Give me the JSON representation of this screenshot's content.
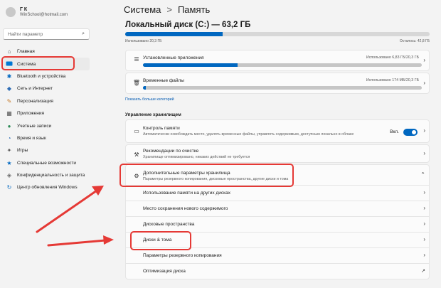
{
  "user": {
    "name": "Г К",
    "email": "WinSchool@hotmail.com"
  },
  "search": {
    "placeholder": "Найти параметр"
  },
  "sidebar": {
    "items": [
      {
        "label": "Главная",
        "icon": "home-icon"
      },
      {
        "label": "Система",
        "icon": "system-icon",
        "active": true
      },
      {
        "label": "Bluetooth и устройства",
        "icon": "bluetooth-icon"
      },
      {
        "label": "Сеть и Интернет",
        "icon": "network-icon"
      },
      {
        "label": "Персонализация",
        "icon": "brush-icon"
      },
      {
        "label": "Приложения",
        "icon": "apps-icon"
      },
      {
        "label": "Учетные записи",
        "icon": "account-icon"
      },
      {
        "label": "Время и язык",
        "icon": "clock-icon"
      },
      {
        "label": "Игры",
        "icon": "gamepad-icon"
      },
      {
        "label": "Специальные возможности",
        "icon": "accessibility-icon"
      },
      {
        "label": "Конфиденциальность и защита",
        "icon": "shield-icon"
      },
      {
        "label": "Центр обновления Windows",
        "icon": "update-icon"
      }
    ]
  },
  "breadcrumb": {
    "parent": "Система",
    "separator": ">",
    "current": "Память"
  },
  "disk": {
    "title": "Локальный диск (C:) — 63,2 ГБ",
    "used_label": "Использовано 20,3 ГБ",
    "free_label": "Осталось: 42,8 ГБ",
    "used_fraction": 0.32
  },
  "categories": [
    {
      "title": "Установленные приложения",
      "usage": "Использовано 6,83 ГБ/20,3 ГБ",
      "fraction": 0.34,
      "icon": "apps-list-icon"
    },
    {
      "title": "Временные файлы",
      "usage": "Использовано 174 МБ/20,3 ГБ",
      "fraction": 0.01,
      "icon": "trash-icon"
    }
  ],
  "more_categories": "Показать больше категорий",
  "management": {
    "section_title": "Управление хранилищем",
    "storage_sense": {
      "title": "Контроль памяти",
      "subtitle": "Автоматически освобождать место, удалять временные файлы, управлять содержимым, доступным локально в облаке",
      "toggle_label": "Вкл."
    },
    "cleanup": {
      "title": "Рекомендации по очистке",
      "subtitle": "Хранилище оптимизировано, никаких действий не требуется"
    },
    "advanced": {
      "title": "Дополнительные параметры хранилища",
      "subtitle": "Параметры резервного копирования, дисковые пространства, другие диски и тома"
    },
    "sub_items": [
      "Использование памяти на других дисках",
      "Место сохранения нового содержимого",
      "Дисковые пространства",
      "Диски & тома",
      "Параметры резервного копирования",
      "Оптимизация диска"
    ]
  },
  "colors": {
    "accent": "#0067c0",
    "annotation": "#e53935"
  }
}
